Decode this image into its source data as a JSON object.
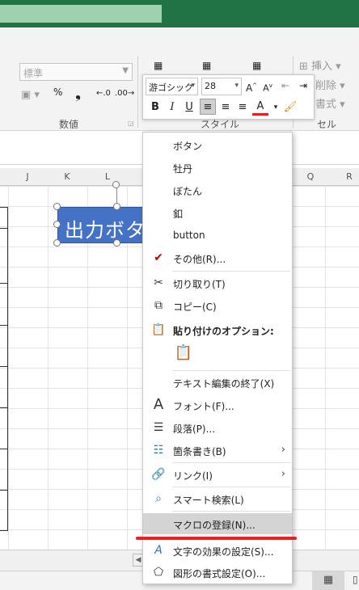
{
  "ribbon": {
    "number_format": "標準",
    "number_group_label": "数値",
    "style_group_label": "スタイル",
    "cells_group_label": "セル",
    "insert_label": "挿入",
    "delete_label": "削除",
    "format_label": "書式",
    "percent_glyph": "%",
    "comma_glyph": "❟"
  },
  "mini_toolbar": {
    "font_name": "游ゴシック",
    "font_size": "28",
    "bold": "B",
    "italic": "I",
    "underline": "U"
  },
  "columns": [
    "J",
    "K",
    "L",
    "Q",
    "R"
  ],
  "shape": {
    "text": "出力ボタ"
  },
  "context_menu": {
    "items": [
      {
        "label": "ボタン"
      },
      {
        "label": "牡丹"
      },
      {
        "label": "ぼたん"
      },
      {
        "label": "釦"
      },
      {
        "label": "button"
      },
      {
        "label": "その他(R)..."
      },
      {
        "label": "切り取り(T)"
      },
      {
        "label": "コピー(C)"
      },
      {
        "label": "貼り付けのオプション:"
      },
      {
        "label": "テキスト編集の終了(X)"
      },
      {
        "label": "フォント(F)..."
      },
      {
        "label": "段落(P)..."
      },
      {
        "label": "箇条書き(B)"
      },
      {
        "label": "リンク(I)"
      },
      {
        "label": "スマート検索(L)"
      },
      {
        "label": "マクロの登録(N)..."
      },
      {
        "label": "文字の効果の設定(S)..."
      },
      {
        "label": "図形の書式設定(O)..."
      }
    ]
  },
  "colors": {
    "titlebar": "#217346",
    "shape_fill": "#4472c4",
    "highlight": "#d4d4d4",
    "annotation_underline": "#e8202a"
  }
}
